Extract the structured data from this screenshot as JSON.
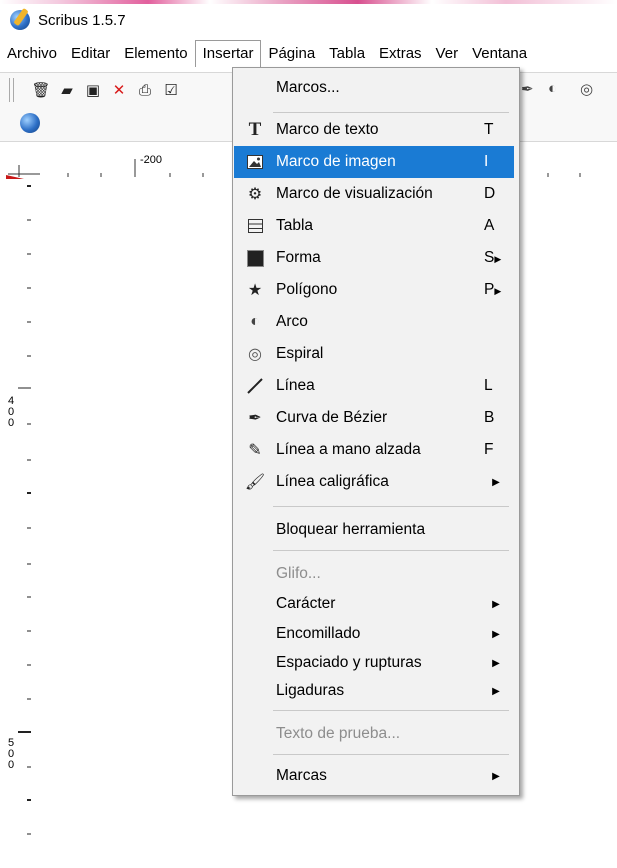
{
  "window": {
    "title": "Scribus 1.5.7"
  },
  "menubar": [
    "Archivo",
    "Editar",
    "Elemento",
    "Insertar",
    "Página",
    "Tabla",
    "Extras",
    "Ver",
    "Ventana"
  ],
  "ruler": {
    "h_label": "-200",
    "v_label_1": "4\n0\n0",
    "v_label_2": "5\n0\n0"
  },
  "insert_menu": [
    {
      "label": "Marcos...",
      "shortcut": "",
      "icon": "none"
    },
    {
      "label": "Marco de texto",
      "shortcut": "T",
      "icon": "text-frame-icon"
    },
    {
      "label": "Marco de imagen",
      "shortcut": "I",
      "icon": "image-frame-icon",
      "highlighted": true
    },
    {
      "label": "Marco de visualización",
      "shortcut": "D",
      "icon": "render-frame-icon"
    },
    {
      "label": "Tabla",
      "shortcut": "A",
      "icon": "table-icon"
    },
    {
      "label": "Forma",
      "shortcut": "S",
      "icon": "shape-icon",
      "submenu": true
    },
    {
      "label": "Polígono",
      "shortcut": "P",
      "icon": "polygon-icon",
      "submenu": true
    },
    {
      "label": "Arco",
      "shortcut": "",
      "icon": "arc-icon"
    },
    {
      "label": "Espiral",
      "shortcut": "",
      "icon": "spiral-icon"
    },
    {
      "label": "Línea",
      "shortcut": "L",
      "icon": "line-icon"
    },
    {
      "label": "Curva de Bézier",
      "shortcut": "B",
      "icon": "bezier-icon"
    },
    {
      "label": "Línea a mano alzada",
      "shortcut": "F",
      "icon": "freehand-icon"
    },
    {
      "label": "Línea caligráfica",
      "shortcut": "",
      "icon": "calligraphic-icon",
      "submenu": true
    },
    {
      "label": "Bloquear herramienta",
      "shortcut": "",
      "icon": "none"
    },
    {
      "label": "Glifo...",
      "shortcut": "",
      "icon": "none",
      "disabled": true
    },
    {
      "label": "Carácter",
      "shortcut": "",
      "icon": "none",
      "submenu": true
    },
    {
      "label": "Encomillado",
      "shortcut": "",
      "icon": "none",
      "submenu": true
    },
    {
      "label": "Espaciado y rupturas",
      "shortcut": "",
      "icon": "none",
      "submenu": true
    },
    {
      "label": "Ligaduras",
      "shortcut": "",
      "icon": "none",
      "submenu": true
    },
    {
      "label": "Texto de prueba...",
      "shortcut": "",
      "icon": "none",
      "disabled": true
    },
    {
      "label": "Marcas",
      "shortcut": "",
      "icon": "none",
      "submenu": true
    }
  ],
  "colors": {
    "highlight": "#1a7bd4",
    "menu_bg": "#f2f2f2",
    "disabled_text": "#8d8d8d"
  }
}
